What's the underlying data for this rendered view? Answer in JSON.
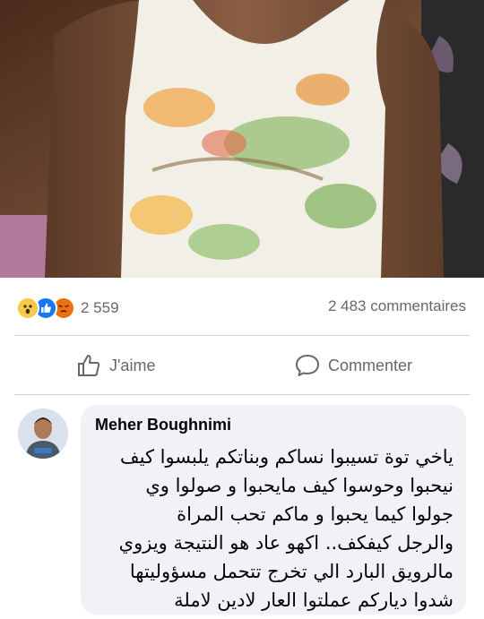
{
  "post": {
    "photo": {
      "description_icon": "photo-icon"
    },
    "reactions": {
      "icons": [
        "wow-reaction-icon",
        "like-reaction-icon",
        "angry-reaction-icon"
      ],
      "count": "2 559"
    },
    "comments_count": "2 483 commentaires",
    "actions": {
      "like_label": "J'aime",
      "comment_label": "Commenter"
    }
  },
  "comment": {
    "author": "Meher Boughnimi",
    "lines": [
      "ياخي توة تسيبوا نساكم وبناتكم يلبسوا كيف",
      "نيحبوا وحوسوا كيف مايحبوا و صولوا وي",
      "جولوا كيما يحبوا و ماكم تحب المراة",
      "والرجل كيفكف.. اكهو عاد هو النتيجة ويزوي",
      "مالرويق البارد الي تخرج تتحمل مسؤوليتها",
      "شدوا دياركم عملتوا العار لادين لاملة"
    ]
  },
  "colors": {
    "facebook_blue": "#1877f2",
    "text_secondary": "#65676b",
    "bubble_bg": "#f0f2f5"
  }
}
